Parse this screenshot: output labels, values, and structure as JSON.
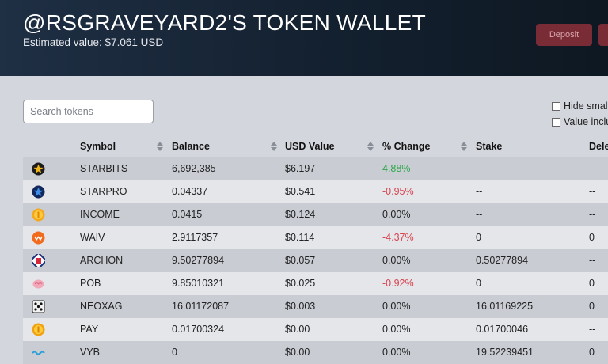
{
  "header": {
    "title": "@RSGRAVEYARD2'S TOKEN WALLET",
    "estimated_value": "Estimated value: $7.061 USD",
    "deposit_label": "Deposit"
  },
  "search": {
    "placeholder": "Search tokens",
    "value": ""
  },
  "filters": {
    "hide_small": "Hide small",
    "value_included": "Value inclu"
  },
  "columns": [
    "Symbol",
    "Balance",
    "USD Value",
    "% Change",
    "Stake",
    "Dele"
  ],
  "colors": {
    "positive": "#2ea84a",
    "negative": "#d9444f",
    "deposit_bg": "#7a2c36"
  },
  "rows": [
    {
      "icon": "starbits-icon",
      "symbol": "STARBITS",
      "balance": "6,692,385",
      "usd": "$6.197",
      "change": "4.88%",
      "change_dir": "pos",
      "stake": "--",
      "delegated": "--"
    },
    {
      "icon": "starpro-icon",
      "symbol": "STARPRO",
      "balance": "0.04337",
      "usd": "$0.541",
      "change": "-0.95%",
      "change_dir": "neg",
      "stake": "--",
      "delegated": "--"
    },
    {
      "icon": "income-icon",
      "symbol": "INCOME",
      "balance": "0.0415",
      "usd": "$0.124",
      "change": "0.00%",
      "change_dir": "zero",
      "stake": "--",
      "delegated": "--"
    },
    {
      "icon": "waiv-icon",
      "symbol": "WAIV",
      "balance": "2.9117357",
      "usd": "$0.114",
      "change": "-4.37%",
      "change_dir": "neg",
      "stake": "0",
      "delegated": "0"
    },
    {
      "icon": "archon-icon",
      "symbol": "ARCHON",
      "balance": "9.50277894",
      "usd": "$0.057",
      "change": "0.00%",
      "change_dir": "zero",
      "stake": "0.50277894",
      "delegated": "--"
    },
    {
      "icon": "pob-icon",
      "symbol": "POB",
      "balance": "9.85010321",
      "usd": "$0.025",
      "change": "-0.92%",
      "change_dir": "neg",
      "stake": "0",
      "delegated": "0"
    },
    {
      "icon": "neoxag-icon",
      "symbol": "NEOXAG",
      "balance": "16.01172087",
      "usd": "$0.003",
      "change": "0.00%",
      "change_dir": "zero",
      "stake": "16.01169225",
      "delegated": "0"
    },
    {
      "icon": "pay-icon",
      "symbol": "PAY",
      "balance": "0.01700324",
      "usd": "$0.00",
      "change": "0.00%",
      "change_dir": "zero",
      "stake": "0.01700046",
      "delegated": "--"
    },
    {
      "icon": "vyb-icon",
      "symbol": "VYB",
      "balance": "0",
      "usd": "$0.00",
      "change": "0.00%",
      "change_dir": "zero",
      "stake": "19.52239451",
      "delegated": "0"
    }
  ]
}
